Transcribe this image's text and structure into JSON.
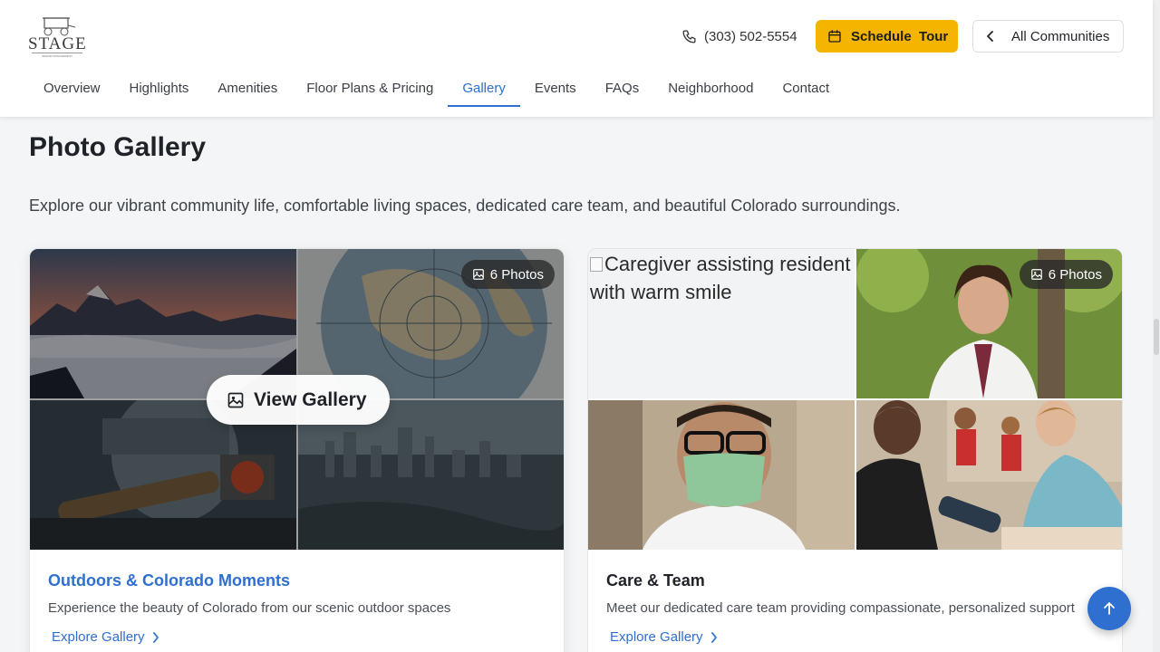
{
  "header": {
    "logo_text": "STAGE",
    "logo_subtext": "SENIOR MANAGEMENT",
    "phone": "(303) 502-5554",
    "schedule_label": "Schedule  Tour",
    "all_communities_label": "All Communities"
  },
  "nav": {
    "items": [
      {
        "label": "Overview"
      },
      {
        "label": "Highlights"
      },
      {
        "label": "Amenities"
      },
      {
        "label": "Floor Plans & Pricing"
      },
      {
        "label": "Gallery"
      },
      {
        "label": "Events"
      },
      {
        "label": "FAQs"
      },
      {
        "label": "Neighborhood"
      },
      {
        "label": "Contact"
      }
    ],
    "active": "Gallery"
  },
  "main": {
    "title": "Photo Gallery",
    "intro": "Explore our vibrant community life, comfortable living spaces, dedicated care team, and beautiful Colorado surroundings."
  },
  "cards": [
    {
      "photo_count": "6 Photos",
      "view_label": "View Gallery",
      "title": "Outdoors & Colorado Moments",
      "description": "Experience the beauty of Colorado from our scenic outdoor spaces",
      "link": "Explore Gallery"
    },
    {
      "photo_count": "6 Photos",
      "broken_image_alt": "Caregiver assisting resident with warm smile",
      "title": "Care & Team",
      "description": "Meet our dedicated care team providing compassionate, personalized support",
      "link": "Explore Gallery"
    }
  ],
  "colors": {
    "accent": "#2f6fcf",
    "schedule_button": "#f5b400"
  }
}
